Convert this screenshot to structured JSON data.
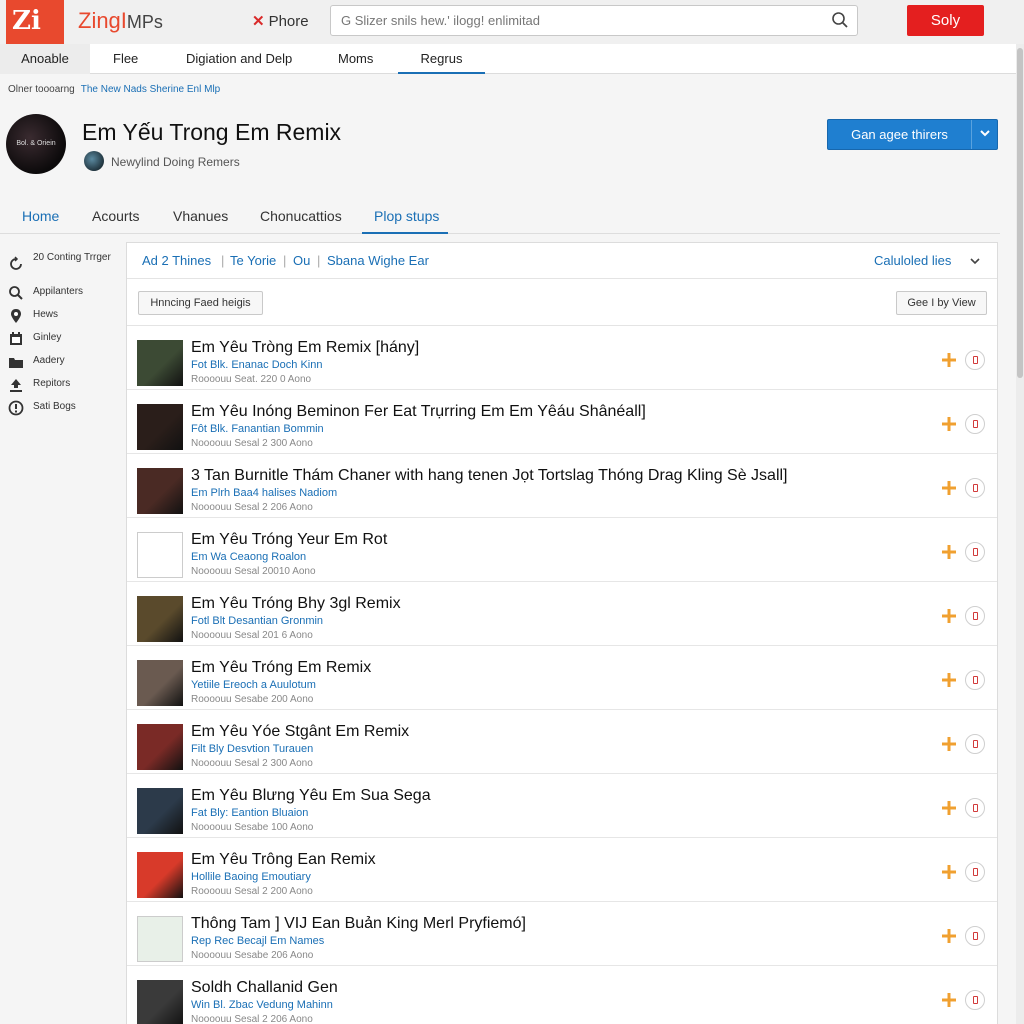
{
  "header": {
    "logo_text": "Zi",
    "brand": "ZingI",
    "brand_suffix": "MPs",
    "phone_label": "Phore",
    "search_placeholder": "G Slizer snils hew.' ilogg! enlimitad",
    "signin_label": "Soly"
  },
  "nav_tabs": [
    "Anoable",
    "Flee",
    "Digiation and Delp",
    "Moms",
    "Regrus"
  ],
  "breadcrumb": {
    "prefix": "Olner toooarng",
    "link": "The New Nads  Sherine Enl Mlp"
  },
  "artist": {
    "avatar_text": "Bol. & Oriein",
    "title": "Em Yếu Trong Em Remix",
    "sub_name": "Newylind Doing Remers",
    "cta_label": "Gan agee thirers"
  },
  "section_tabs": [
    "Home",
    "Acourts",
    "Vhanues",
    "Chonucattios",
    "Plop stups"
  ],
  "sidebar": [
    {
      "label": "20 Conting Trrger",
      "icon": "refresh-icon"
    },
    {
      "label": "Appilanters",
      "icon": "search-icon"
    },
    {
      "label": "Hews",
      "icon": "location-pin-icon"
    },
    {
      "label": "Ginley",
      "icon": "calendar-icon"
    },
    {
      "label": "Aadery",
      "icon": "folder-icon"
    },
    {
      "label": "Repitors",
      "icon": "upload-icon"
    },
    {
      "label": "Sati Bogs",
      "icon": "info-icon"
    }
  ],
  "filters": [
    "Ad 2 Thines",
    "Te Yorie",
    "Ou",
    "Sbana Wighe Ear"
  ],
  "collected_label": "Caluloled lies",
  "buttons": {
    "left": "Hnncing Faed heigis",
    "right": "Gee I by View"
  },
  "tracks": [
    {
      "title": "Em Yêu Tròng Em Remix [hány]",
      "artist": "Fot Blk. Enanac Doch Kinn",
      "meta": "Roooouu Seat. 220 0 Aono",
      "thumb_color": "#3c4a34"
    },
    {
      "title": "Em Yêu Inóng Beminon Fer Eat Trụrring Em Em Yêáu Shânéall]",
      "artist": "Fôt Blk. Fanantian Bommin",
      "meta": "Noooouu Sesal 2 300 Aono",
      "thumb_color": "#2a1e1a"
    },
    {
      "title": "3 Tan Burnitle Thám Chaner with hang tenen Jọt Tortslag Thóng Drag Kling Sè Jsall]",
      "artist": "Em Plrh Baa4 halises Nadiom",
      "meta": "Noooouu Sesal 2 206 Aono",
      "thumb_color": "#4a2a24"
    },
    {
      "title": "Em Yêu Tróng Yeur Em Rot",
      "artist": "Em Wa Ceaong Roalon",
      "meta": "Noooouu Sesal 20010 Aono",
      "thumb_color": "#ffffff"
    },
    {
      "title": "Em Yêu Tróng Bhy 3gl Remix",
      "artist": "Fotl Blt Desantian Gronmin",
      "meta": "Noooouu Sesal 201 6 Aono",
      "thumb_color": "#5a4a2c"
    },
    {
      "title": "Em Yêu Tróng Em Remix",
      "artist": "Yetiile Ereoch a Auulotum",
      "meta": "Roooouu Sesabe 200 Aono",
      "thumb_color": "#6a5a50"
    },
    {
      "title": "Em Yêu Yóe Stgânt Em Remix",
      "artist": "Filt Bly Desvtion Turauen",
      "meta": "Noooouu Sesal 2 300 Aono",
      "thumb_color": "#7a2a26"
    },
    {
      "title": "Em Yêu Blưng Yêu Em Sua Sega",
      "artist": "Fat Bly: Eantion Bluaion",
      "meta": "Noooouu Sesabe 100 Aono",
      "thumb_color": "#2c3a4a"
    },
    {
      "title": "Em Yêu Trông Ean Remix",
      "artist": "Hollile Baoing Emoutiary",
      "meta": "Roooouu Sesal 2 200 Aono",
      "thumb_color": "#d83a2a"
    },
    {
      "title": "Thông Tam ] VIJ Ean Buản King Merl Pryfiemó]",
      "artist": "Rep Rec Becajl Em Names",
      "meta": "Noooouu Sesabe 206 Aono",
      "thumb_color": "#e8f0e8"
    },
    {
      "title": "Soldh Challanid Gen",
      "artist": "Win Bl. Zbac Vedung Mahinn",
      "meta": "Noooouu Sesal 2 206 Aono",
      "thumb_color": "#3a3a3a"
    }
  ],
  "colors": {
    "accent": "#1a6fb5",
    "brand_red": "#e8492e",
    "signin_red": "#e41f1f",
    "add_orange": "#f0a030"
  }
}
